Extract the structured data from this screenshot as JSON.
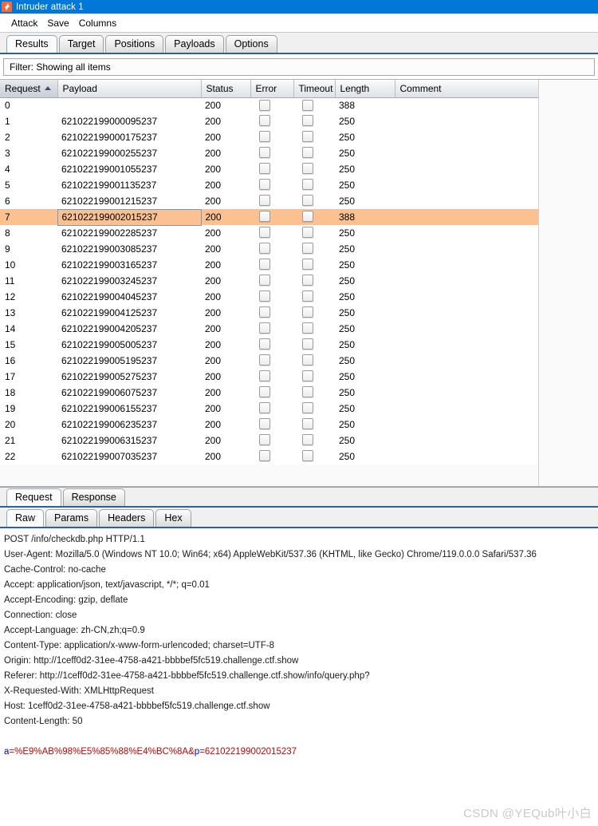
{
  "window": {
    "title": "Intruder attack 1",
    "icon": "burp-suite-icon"
  },
  "menu": {
    "items": [
      {
        "label": "Attack"
      },
      {
        "label": "Save"
      },
      {
        "label": "Columns"
      }
    ]
  },
  "main_tabs": {
    "selected": "Results",
    "items": [
      {
        "label": "Results"
      },
      {
        "label": "Target"
      },
      {
        "label": "Positions"
      },
      {
        "label": "Payloads"
      },
      {
        "label": "Options"
      }
    ]
  },
  "filter": {
    "label": "Filter: Showing all items"
  },
  "results_table": {
    "sort_column": "Request",
    "sort_direction": "ascending",
    "columns": [
      {
        "key": "request",
        "label": "Request"
      },
      {
        "key": "payload",
        "label": "Payload"
      },
      {
        "key": "status",
        "label": "Status"
      },
      {
        "key": "error",
        "label": "Error"
      },
      {
        "key": "timeout",
        "label": "Timeout"
      },
      {
        "key": "length",
        "label": "Length"
      },
      {
        "key": "comment",
        "label": "Comment"
      }
    ],
    "selected_row_index": 7,
    "rows": [
      {
        "request": "0",
        "payload": "",
        "status": "200",
        "error": false,
        "timeout": false,
        "length": "388",
        "comment": ""
      },
      {
        "request": "1",
        "payload": "621022199000095237",
        "status": "200",
        "error": false,
        "timeout": false,
        "length": "250",
        "comment": ""
      },
      {
        "request": "2",
        "payload": "621022199000175237",
        "status": "200",
        "error": false,
        "timeout": false,
        "length": "250",
        "comment": ""
      },
      {
        "request": "3",
        "payload": "621022199000255237",
        "status": "200",
        "error": false,
        "timeout": false,
        "length": "250",
        "comment": ""
      },
      {
        "request": "4",
        "payload": "621022199001055237",
        "status": "200",
        "error": false,
        "timeout": false,
        "length": "250",
        "comment": ""
      },
      {
        "request": "5",
        "payload": "621022199001135237",
        "status": "200",
        "error": false,
        "timeout": false,
        "length": "250",
        "comment": ""
      },
      {
        "request": "6",
        "payload": "621022199001215237",
        "status": "200",
        "error": false,
        "timeout": false,
        "length": "250",
        "comment": ""
      },
      {
        "request": "7",
        "payload": "621022199002015237",
        "status": "200",
        "error": false,
        "timeout": false,
        "length": "388",
        "comment": ""
      },
      {
        "request": "8",
        "payload": "621022199002285237",
        "status": "200",
        "error": false,
        "timeout": false,
        "length": "250",
        "comment": ""
      },
      {
        "request": "9",
        "payload": "621022199003085237",
        "status": "200",
        "error": false,
        "timeout": false,
        "length": "250",
        "comment": ""
      },
      {
        "request": "10",
        "payload": "621022199003165237",
        "status": "200",
        "error": false,
        "timeout": false,
        "length": "250",
        "comment": ""
      },
      {
        "request": "11",
        "payload": "621022199003245237",
        "status": "200",
        "error": false,
        "timeout": false,
        "length": "250",
        "comment": ""
      },
      {
        "request": "12",
        "payload": "621022199004045237",
        "status": "200",
        "error": false,
        "timeout": false,
        "length": "250",
        "comment": ""
      },
      {
        "request": "13",
        "payload": "621022199004125237",
        "status": "200",
        "error": false,
        "timeout": false,
        "length": "250",
        "comment": ""
      },
      {
        "request": "14",
        "payload": "621022199004205237",
        "status": "200",
        "error": false,
        "timeout": false,
        "length": "250",
        "comment": ""
      },
      {
        "request": "15",
        "payload": "621022199005005237",
        "status": "200",
        "error": false,
        "timeout": false,
        "length": "250",
        "comment": ""
      },
      {
        "request": "16",
        "payload": "621022199005195237",
        "status": "200",
        "error": false,
        "timeout": false,
        "length": "250",
        "comment": ""
      },
      {
        "request": "17",
        "payload": "621022199005275237",
        "status": "200",
        "error": false,
        "timeout": false,
        "length": "250",
        "comment": ""
      },
      {
        "request": "18",
        "payload": "621022199006075237",
        "status": "200",
        "error": false,
        "timeout": false,
        "length": "250",
        "comment": ""
      },
      {
        "request": "19",
        "payload": "621022199006155237",
        "status": "200",
        "error": false,
        "timeout": false,
        "length": "250",
        "comment": ""
      },
      {
        "request": "20",
        "payload": "621022199006235237",
        "status": "200",
        "error": false,
        "timeout": false,
        "length": "250",
        "comment": ""
      },
      {
        "request": "21",
        "payload": "621022199006315237",
        "status": "200",
        "error": false,
        "timeout": false,
        "length": "250",
        "comment": ""
      },
      {
        "request": "22",
        "payload": "621022199007035237",
        "status": "200",
        "error": false,
        "timeout": false,
        "length": "250",
        "comment": ""
      }
    ]
  },
  "message_tabs": {
    "selected": "Request",
    "items": [
      {
        "label": "Request"
      },
      {
        "label": "Response"
      }
    ]
  },
  "view_tabs": {
    "selected": "Raw",
    "items": [
      {
        "label": "Raw"
      },
      {
        "label": "Params"
      },
      {
        "label": "Headers"
      },
      {
        "label": "Hex"
      }
    ]
  },
  "raw_request": {
    "lines": [
      "POST /info/checkdb.php HTTP/1.1",
      "User-Agent: Mozilla/5.0 (Windows NT 10.0; Win64; x64) AppleWebKit/537.36 (KHTML, like Gecko) Chrome/119.0.0.0 Safari/537.36",
      "Cache-Control: no-cache",
      "Accept: application/json, text/javascript, */*; q=0.01",
      "Accept-Encoding: gzip, deflate",
      "Connection: close",
      "Accept-Language: zh-CN,zh;q=0.9",
      "Content-Type: application/x-www-form-urlencoded; charset=UTF-8",
      "Origin: http://1ceff0d2-31ee-4758-a421-bbbbef5fc519.challenge.ctf.show",
      "Referer: http://1ceff0d2-31ee-4758-a421-bbbbef5fc519.challenge.ctf.show/info/query.php?",
      "X-Requested-With: XMLHttpRequest",
      "Host: 1ceff0d2-31ee-4758-a421-bbbbef5fc519.challenge.ctf.show",
      "Content-Length: 50"
    ],
    "body": {
      "param1_name": "a",
      "param1_value": "=%E9%AB%98%E5%85%88%E4%BC%8A",
      "separator": "&",
      "param2_name": "p",
      "param2_value": "=621022199002015237"
    }
  },
  "watermark": {
    "text": "CSDN @YEQub叶小白"
  },
  "colors": {
    "titlebar": "#0078d7",
    "selection_row": "#fcc190",
    "tab_accent": "#2a6496",
    "param_name": "#0000cc",
    "param_value": "#cc0000"
  }
}
